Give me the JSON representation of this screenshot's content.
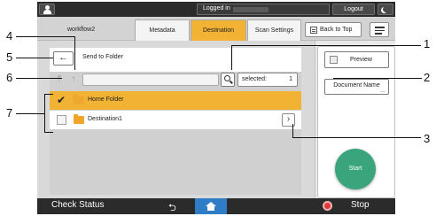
{
  "topbar": {
    "login_label": "Logged in",
    "logout_label": "Logout"
  },
  "header": {
    "workflow_title": "workflow2",
    "tabs": [
      {
        "label": "Metadata"
      },
      {
        "label": "Destination"
      },
      {
        "label": "Scan Settings"
      }
    ],
    "back_to_top_label": "Back to Top"
  },
  "main": {
    "back_icon": "←",
    "title": "Send to Folder",
    "up_to_top_icon": "⤒",
    "up_one_icon": "↑",
    "path_value": "",
    "selected_label": "selected:",
    "selected_count": "1",
    "folders": [
      {
        "label": "Home Folder",
        "checked": true,
        "check_icon": "✔"
      },
      {
        "label": "Destination1",
        "checked": false,
        "chevron_icon": "›"
      }
    ]
  },
  "right": {
    "preview_label": "Preview",
    "document_name_label": "Document Name",
    "document_name_more": "...",
    "start_label": "Start"
  },
  "bottom": {
    "check_status_label": "Check Status",
    "reset_icon": "⮌",
    "stop_label": "Stop"
  },
  "callouts": [
    "1",
    "2",
    "3",
    "4",
    "5",
    "6",
    "7"
  ],
  "colors": {
    "accent": "#f2b233",
    "start": "#3aa47d",
    "home_button": "#2f7cc7",
    "stop": "#e03a3a",
    "bar_dark": "#2b2b2b"
  }
}
